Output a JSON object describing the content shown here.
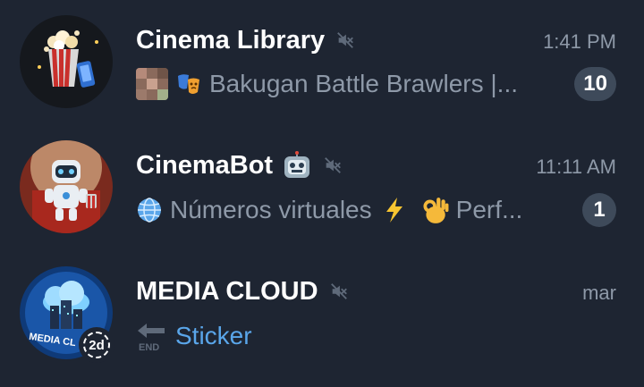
{
  "chats": [
    {
      "name": "Cinema Library",
      "time": "1:41 PM",
      "muted": true,
      "preview_text": "Bakugan Battle Brawlers |...",
      "unread": "10"
    },
    {
      "name": "CinemaBot",
      "time": "11:11 AM",
      "muted": true,
      "preview_text": "Números virtuales",
      "preview_text_2": "Perf...",
      "unread": "1"
    },
    {
      "name": "MEDIA CLOUD",
      "time": "mar",
      "muted": true,
      "avatar_label": "MEDIA CL",
      "story_badge": "2d",
      "preview_text": "Sticker",
      "preview_icon_label": "END"
    }
  ],
  "colors": {
    "background": "#1e2532",
    "name": "#ffffff",
    "secondary_text": "#8e99a8",
    "badge": "#3e4a5a",
    "link_accent": "#5aa6ea"
  },
  "icons": [
    "mute-icon",
    "robot-emoji-icon",
    "theater-masks-icon",
    "globe-icon",
    "lightning-icon",
    "ok-hand-icon",
    "end-arrow-icon"
  ]
}
